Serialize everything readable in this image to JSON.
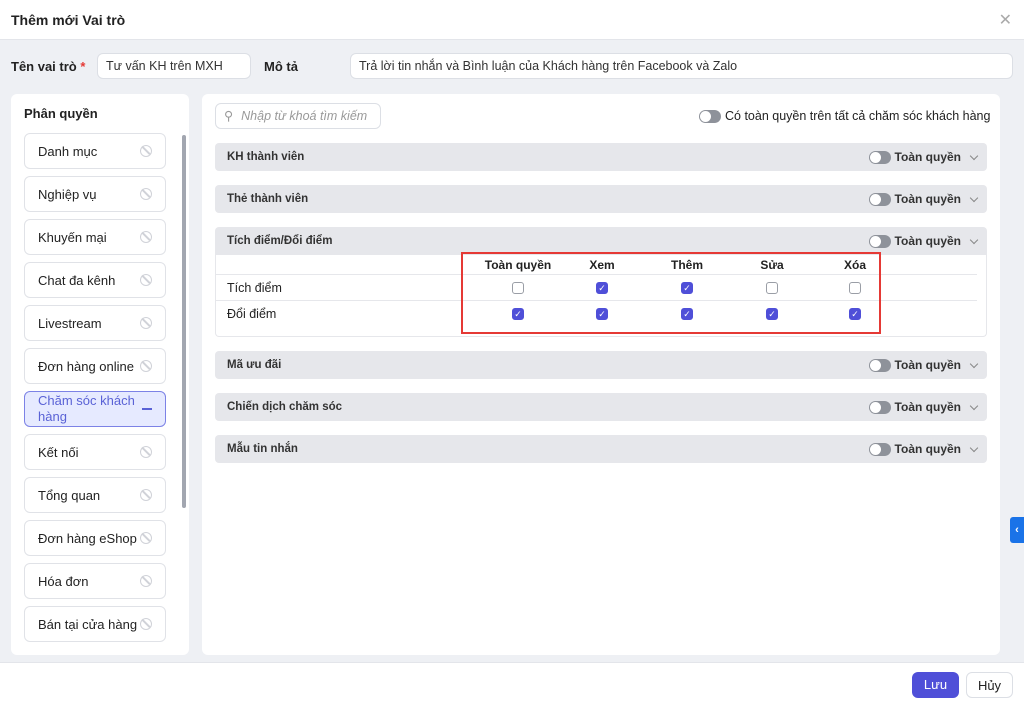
{
  "title": "Thêm mới Vai trò",
  "form": {
    "name_label": "Tên vai trò",
    "required": "*",
    "name_value": "Tư vấn KH trên MXH",
    "desc_label": "Mô tả",
    "desc_value": "Trả lời tin nhắn và Bình luận của Khách hàng trên Facebook và Zalo"
  },
  "sidebar": {
    "title": "Phân quyền",
    "items": [
      {
        "label": "Danh mục"
      },
      {
        "label": "Nghiệp vụ"
      },
      {
        "label": "Khuyến mại"
      },
      {
        "label": "Chat đa kênh"
      },
      {
        "label": "Livestream"
      },
      {
        "label": "Đơn hàng online"
      },
      {
        "label": "Chăm sóc khách hàng",
        "selected": true
      },
      {
        "label": "Kết nối"
      },
      {
        "label": "Tổng quan"
      },
      {
        "label": "Đơn hàng eShop"
      },
      {
        "label": "Hóa đơn"
      },
      {
        "label": "Bán tại cửa hàng"
      }
    ]
  },
  "search": {
    "placeholder": "Nhập từ khoá tìm kiếm"
  },
  "global_toggle": "Có toàn quyền trên tất cả chăm sóc khách hàng",
  "toggle_label": "Toàn quyền",
  "sections": [
    {
      "title": "KH thành viên"
    },
    {
      "title": "Thẻ thành viên"
    },
    {
      "title": "Tích điểm/Đổi điểm"
    },
    {
      "title": "Mã ưu đãi"
    },
    {
      "title": "Chiến dịch chăm sóc"
    },
    {
      "title": "Mẫu tin nhắn"
    }
  ],
  "table": {
    "columns": [
      "Toàn quyền",
      "Xem",
      "Thêm",
      "Sửa",
      "Xóa"
    ],
    "rows": [
      {
        "label": "Tích điểm",
        "checks": [
          false,
          true,
          true,
          false,
          false
        ]
      },
      {
        "label": "Đổi điểm",
        "checks": [
          true,
          true,
          true,
          true,
          true
        ]
      }
    ]
  },
  "footer": {
    "save": "Lưu",
    "cancel": "Hủy"
  },
  "colors": {
    "accent": "#4f4fd8",
    "highlight": "#e53935",
    "side_tab": "#1a73e8"
  }
}
